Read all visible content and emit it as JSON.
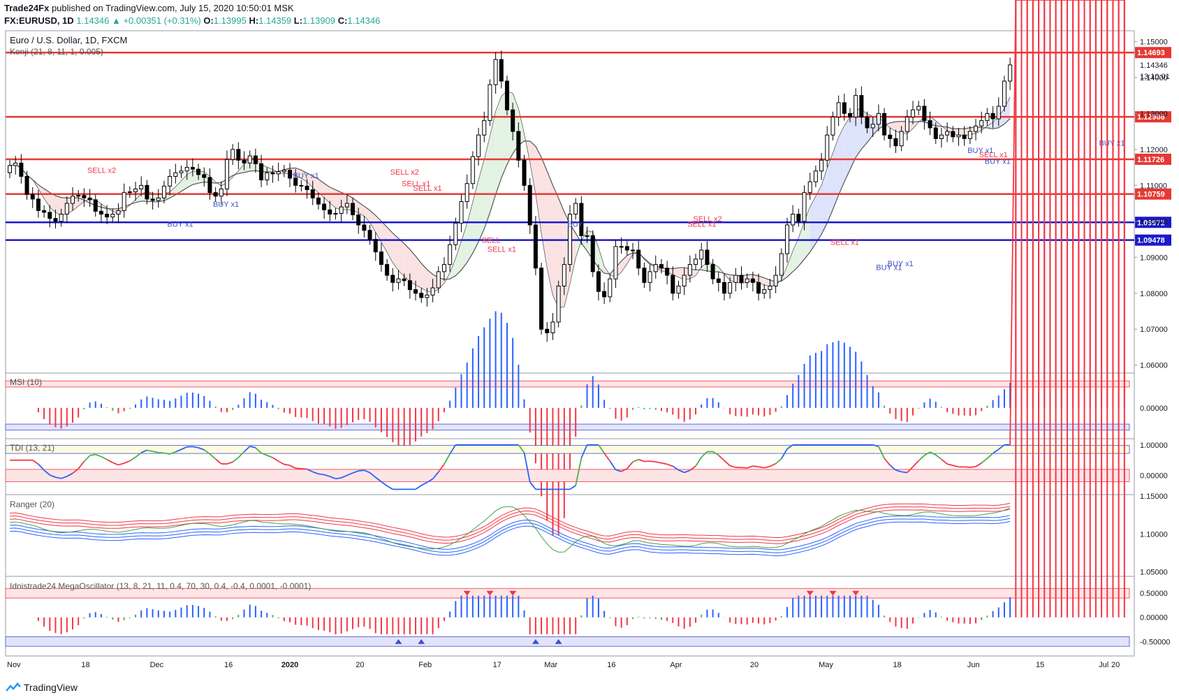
{
  "header": {
    "author": "Trade24Fx",
    "published": "published on TradingView.com, July 15, 2020 10:50:01 MSK",
    "symbol": "FX:EURUSD, 1D",
    "last": "1.14346",
    "arrow": "▲",
    "change": "+0.00351 (+0.31%)",
    "o_label": "O:",
    "o": "1.13995",
    "h_label": "H:",
    "h": "1.14359",
    "l_label": "L:",
    "l": "1.13909",
    "c_label": "C:",
    "c": "1.14346"
  },
  "footer": {
    "brand": "TradingView",
    "logo_icon": "tradingview-logo-icon"
  },
  "colors": {
    "up": "#26a69a",
    "red_level": "#e53935",
    "blue_level": "#1a1ac8",
    "bull_line": "#2962ff",
    "bear_line": "#f23645",
    "neutral": "#4caf50"
  },
  "chart_data": [
    {
      "type": "candlestick",
      "title": "Euro / U.S. Dollar, 1D, FXCM",
      "subtitle": "Kenji (21, 8, 11, 1, 0.005)",
      "ylim": [
        1.058,
        1.153
      ],
      "y_ticks": [
        "1.15000",
        "1.14000",
        "1.13000",
        "1.12000",
        "1.11000",
        "1.10000",
        "1.09000",
        "1.08000",
        "1.07000",
        "1.06000"
      ],
      "y_tick_values": [
        1.15,
        1.14,
        1.13,
        1.12,
        1.11,
        1.1,
        1.09,
        1.08,
        1.07,
        1.06
      ],
      "x_ticks": [
        "Nov",
        "18",
        "Dec",
        "16",
        "2020",
        "20",
        "Feb",
        "17",
        "Mar",
        "16",
        "Apr",
        "20",
        "May",
        "18",
        "Jun",
        "15",
        "Jul",
        "20"
      ],
      "current_price_label": "1.14346",
      "time_label": "13:10:01",
      "levels": [
        {
          "value": 1.14693,
          "label": "1.14693",
          "color": "red"
        },
        {
          "value": 1.12906,
          "label": "1.12906",
          "color": "red"
        },
        {
          "value": 1.11726,
          "label": "1.11726",
          "color": "red"
        },
        {
          "value": 1.10759,
          "label": "1.10759",
          "color": "red"
        },
        {
          "value": 1.09972,
          "label": "1.09972",
          "color": "blue"
        },
        {
          "value": 1.09478,
          "label": "1.09478",
          "color": "blue"
        }
      ],
      "closes": [
        1.1155,
        1.1162,
        1.1125,
        1.1075,
        1.1062,
        1.103,
        1.1025,
        1.1008,
        1.1,
        1.102,
        1.105,
        1.107,
        1.1072,
        1.1065,
        1.106,
        1.1028,
        1.102,
        1.1012,
        1.102,
        1.103,
        1.108,
        1.1082,
        1.109,
        1.11,
        1.1062,
        1.1058,
        1.1065,
        1.1098,
        1.1125,
        1.1135,
        1.114,
        1.115,
        1.1145,
        1.113,
        1.1122,
        1.108,
        1.107,
        1.109,
        1.1172,
        1.12,
        1.117,
        1.1162,
        1.1182,
        1.116,
        1.1115,
        1.1135,
        1.1132,
        1.1138,
        1.1142,
        1.112,
        1.11,
        1.1098,
        1.1088,
        1.1065,
        1.1048,
        1.1032,
        1.102,
        1.1022,
        1.104,
        1.105,
        1.1018,
        1.099,
        1.0975,
        1.095,
        1.0915,
        1.088,
        1.085,
        1.083,
        1.084,
        1.0835,
        1.081,
        1.08,
        1.0788,
        1.0795,
        1.0815,
        1.086,
        1.088,
        1.0935,
        1.0995,
        1.1055,
        1.1105,
        1.118,
        1.124,
        1.128,
        1.138,
        1.145,
        1.139,
        1.131,
        1.125,
        1.117,
        1.11,
        1.099,
        1.087,
        1.07,
        1.069,
        1.072,
        1.082,
        1.088,
        1.102,
        1.105,
        1.096,
        1.096,
        1.086,
        1.0805,
        1.079,
        1.084,
        1.093,
        1.093,
        1.092,
        1.092,
        1.087,
        1.083,
        1.086,
        1.088,
        1.087,
        1.085,
        1.08,
        1.082,
        1.085,
        1.088,
        1.0895,
        1.092,
        1.088,
        1.084,
        1.083,
        1.08,
        1.083,
        1.085,
        1.083,
        1.084,
        1.083,
        1.08,
        1.081,
        1.082,
        1.085,
        1.091,
        1.099,
        1.102,
        1.1,
        1.108,
        1.111,
        1.114,
        1.117,
        1.124,
        1.129,
        1.133,
        1.13,
        1.129,
        1.135,
        1.129,
        1.126,
        1.127,
        1.13,
        1.124,
        1.123,
        1.121,
        1.125,
        1.129,
        1.131,
        1.132,
        1.128,
        1.126,
        1.123,
        1.124,
        1.125,
        1.1235,
        1.124,
        1.123,
        1.125,
        1.1265,
        1.128,
        1.13,
        1.1285,
        1.132,
        1.139,
        1.1435
      ],
      "markers": [
        {
          "text": "SELL x2",
          "kind": "sell",
          "date_index": 16,
          "price": 1.1135
        },
        {
          "text": "BUY x1",
          "kind": "buy",
          "date_index": 30,
          "price": 1.0985
        },
        {
          "text": "BUY x1",
          "kind": "buy",
          "date_index": 38,
          "price": 1.104
        },
        {
          "text": "BUY x1",
          "kind": "buy",
          "date_index": 52,
          "price": 1.112
        },
        {
          "text": "SELL x2",
          "kind": "sell",
          "date_index": 69,
          "price": 1.113
        },
        {
          "text": "SELL x1",
          "kind": "sell",
          "date_index": 71,
          "price": 1.1098
        },
        {
          "text": "SELL x1",
          "kind": "sell",
          "date_index": 73,
          "price": 1.1085
        },
        {
          "text": "SELL",
          "kind": "sell",
          "date_index": 85,
          "price": 1.094
        },
        {
          "text": "SELL x1",
          "kind": "sell",
          "date_index": 86,
          "price": 1.0915
        },
        {
          "text": "BUY",
          "kind": "buy",
          "date_index": 100,
          "price": 1.0985
        },
        {
          "text": "SELL x2",
          "kind": "sell",
          "date_index": 122,
          "price": 1.1
        },
        {
          "text": "SELL x1",
          "kind": "sell",
          "date_index": 121,
          "price": 1.0985
        },
        {
          "text": "SELL x1",
          "kind": "sell",
          "date_index": 146,
          "price": 1.0935
        },
        {
          "text": "BUY x1",
          "kind": "buy",
          "date_index": 156,
          "price": 1.0875
        },
        {
          "text": "BUY x1",
          "kind": "buy",
          "date_index": 154,
          "price": 1.0865
        },
        {
          "text": "BUY x1",
          "kind": "buy",
          "date_index": 170,
          "price": 1.119
        },
        {
          "text": "SELL x1",
          "kind": "sell",
          "date_index": 172,
          "price": 1.1178
        },
        {
          "text": "BUY x1",
          "kind": "buy",
          "date_index": 173,
          "price": 1.116
        },
        {
          "text": "BUY x1",
          "kind": "buy",
          "date_index": 193,
          "price": 1.121
        }
      ]
    },
    {
      "type": "bar",
      "title": "MSI (10)",
      "y_ticks": [
        "0.00000"
      ],
      "ylim": [
        -0.0065,
        0.0075
      ],
      "upper_band": [
        0.0045,
        0.0058
      ],
      "lower_band": [
        -0.0048,
        -0.0035
      ]
    },
    {
      "type": "line",
      "title": "TDI (13, 21)",
      "y_ticks": [
        "1.00000",
        "0.00000"
      ],
      "ylim": [
        -0.6,
        1.2
      ],
      "upper_band": [
        0.72,
        0.98
      ],
      "lower_band": [
        -0.2,
        0.2
      ]
    },
    {
      "type": "line",
      "title": "Ranger (20)",
      "y_ticks": [
        "1.15000",
        "1.10000",
        "1.05000"
      ],
      "ylim": [
        1.045,
        1.152
      ]
    },
    {
      "type": "bar",
      "title": "Idnistrade24 MegaOscillator (13, 8, 21, 11, 0.4, 70, 30, 0.4, -0.4, 0.0001, -0.0001)",
      "y_ticks": [
        "0.50000",
        "0.00000",
        "-0.50000"
      ],
      "ylim": [
        -0.8,
        0.85
      ],
      "upper_band": [
        0.4,
        0.6
      ],
      "lower_band": [
        -0.6,
        -0.4
      ]
    }
  ]
}
